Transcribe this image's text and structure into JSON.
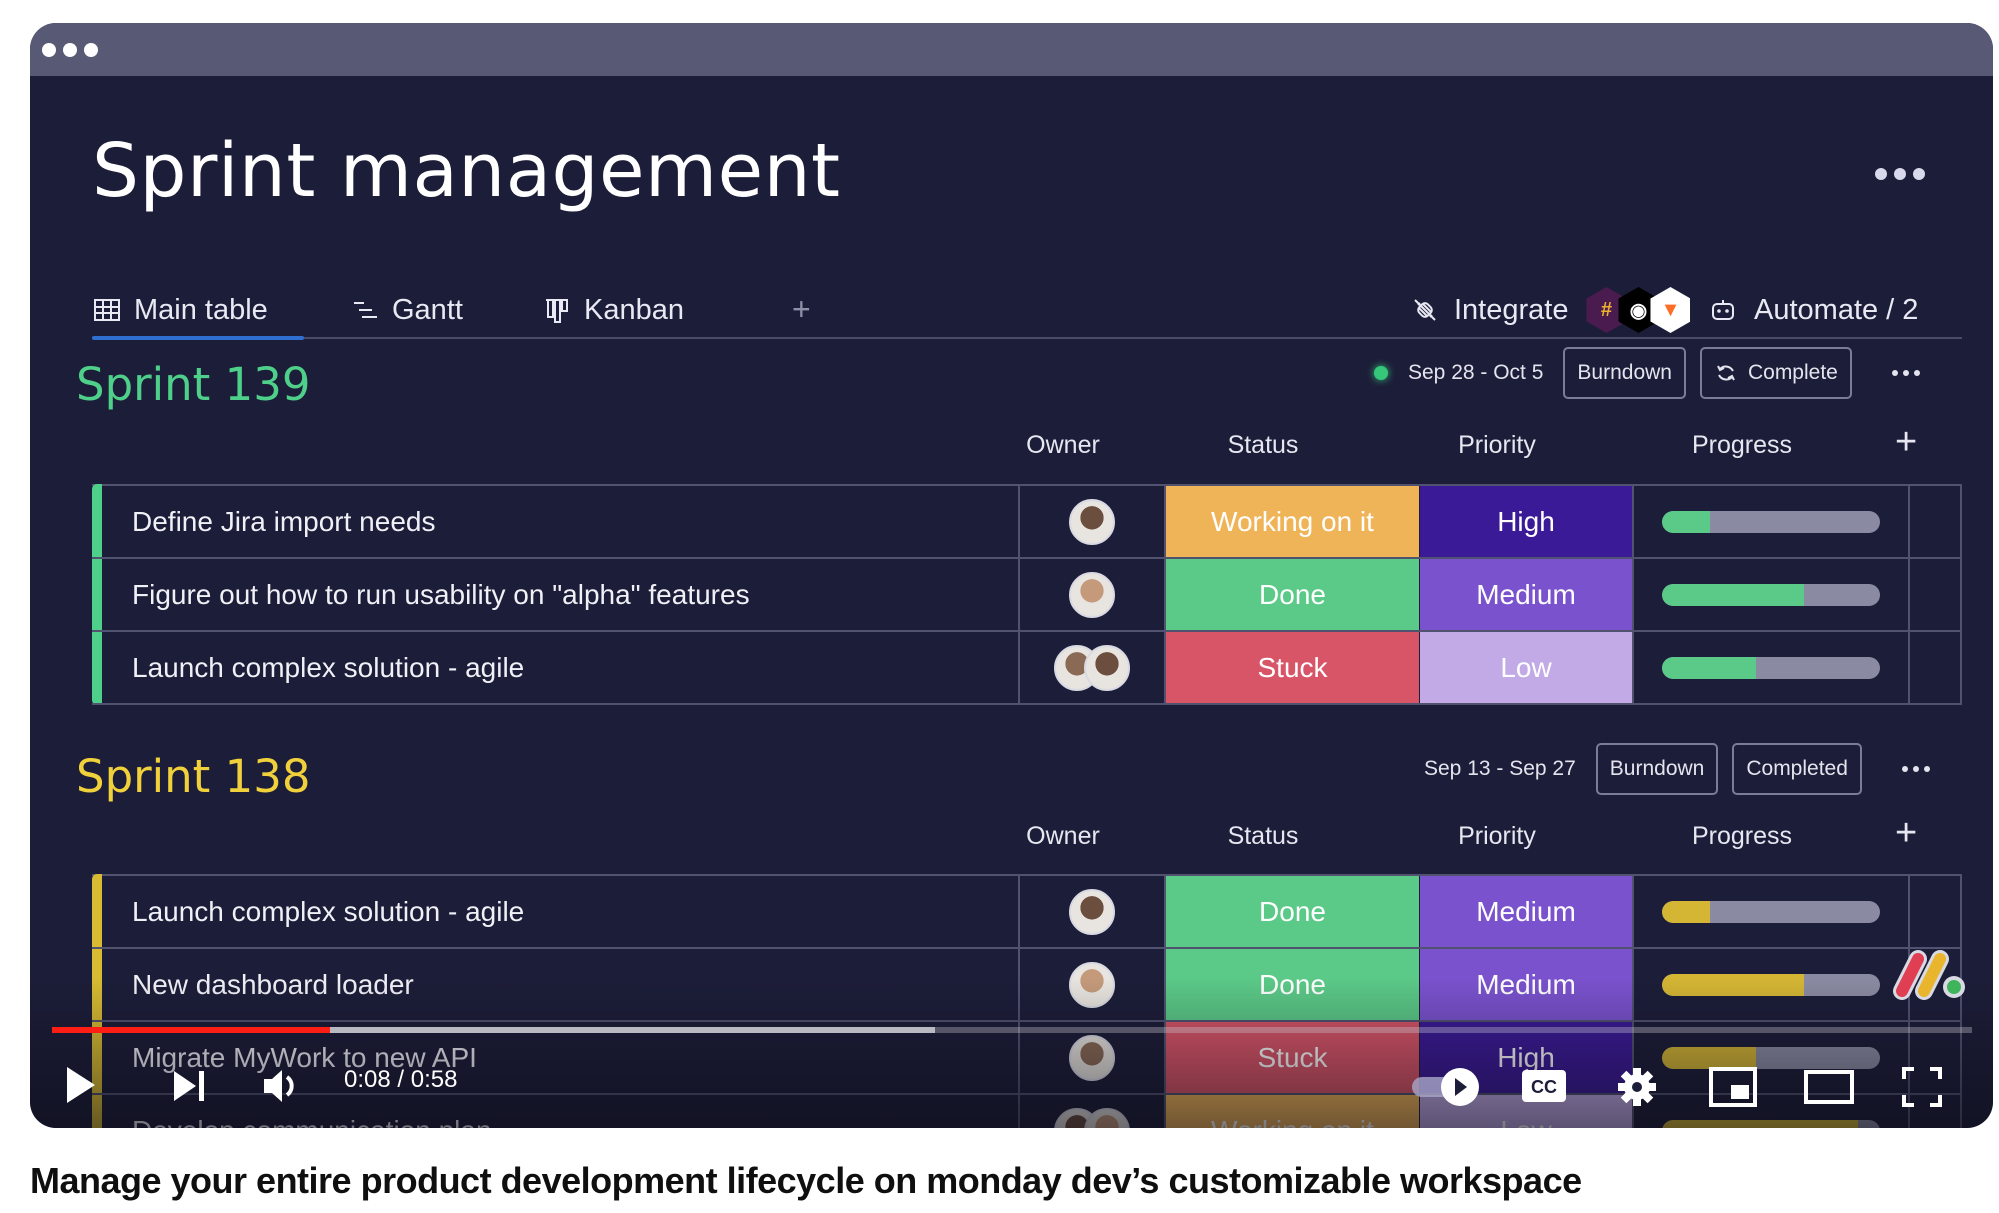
{
  "page_title": "Sprint management",
  "tabs": [
    {
      "label": "Main table",
      "icon": "table-icon",
      "active": true
    },
    {
      "label": "Gantt",
      "icon": "gantt-icon",
      "active": false
    },
    {
      "label": "Kanban",
      "icon": "kanban-icon",
      "active": false
    }
  ],
  "add_tab_label": "+",
  "integrate": {
    "label": "Integrate",
    "apps": [
      "slack",
      "github",
      "gitlab"
    ]
  },
  "automate": {
    "label": "Automate / 2"
  },
  "columns": {
    "owner": "Owner",
    "status": "Status",
    "priority": "Priority",
    "progress": "Progress",
    "add": "+"
  },
  "colors": {
    "working": "#f0b458",
    "done": "#5bc987",
    "stuck": "#d85568",
    "high": "#3b1a97",
    "medium": "#7a52cd",
    "low": "#c1aae6",
    "sprint139": "#4fd08a",
    "sprint138": "#f0d13b"
  },
  "sprints": [
    {
      "title": "Sprint 139",
      "date_range": "Sep 28 - Oct 5",
      "active_indicator": true,
      "burndown_label": "Burndown",
      "complete_label": "Complete",
      "rows": [
        {
          "name": "Define Jira import needs",
          "owners": 1,
          "status": "Working on it",
          "status_key": "working",
          "priority": "High",
          "priority_key": "high",
          "progress": 0.22
        },
        {
          "name": "Figure out how to run usability on \"alpha\" features",
          "owners": 1,
          "status": "Done",
          "status_key": "done",
          "priority": "Medium",
          "priority_key": "medium",
          "progress": 0.65
        },
        {
          "name": "Launch complex solution - agile",
          "owners": 2,
          "status": "Stuck",
          "status_key": "stuck",
          "priority": "Low",
          "priority_key": "low",
          "progress": 0.43
        }
      ]
    },
    {
      "title": "Sprint 138",
      "date_range": "Sep 13 - Sep 27",
      "active_indicator": false,
      "burndown_label": "Burndown",
      "complete_label": "Completed",
      "rows": [
        {
          "name": "Launch complex solution - agile",
          "owners": 1,
          "status": "Done",
          "status_key": "done",
          "priority": "Medium",
          "priority_key": "medium",
          "progress": 0.22
        },
        {
          "name": "New dashboard loader",
          "owners": 1,
          "status": "Done",
          "status_key": "done",
          "priority": "Medium",
          "priority_key": "medium",
          "progress": 0.65
        },
        {
          "name": "Migrate MyWork to new API",
          "owners": 1,
          "status": "Stuck",
          "status_key": "stuck",
          "priority": "High",
          "priority_key": "high",
          "progress": 0.43
        },
        {
          "name": "Develop communication plan",
          "owners": 2,
          "status": "Working on it",
          "status_key": "working",
          "priority": "Low",
          "priority_key": "low",
          "progress": 0.9
        }
      ]
    }
  ],
  "video": {
    "current_time": "0:08",
    "duration": "0:58",
    "time_display": "0:08 / 0:58",
    "played_fraction": 0.145,
    "buffered_fraction": 0.46,
    "autoplay_on": true
  },
  "caption": "Manage your entire product development lifecycle on monday dev’s customizable workspace"
}
